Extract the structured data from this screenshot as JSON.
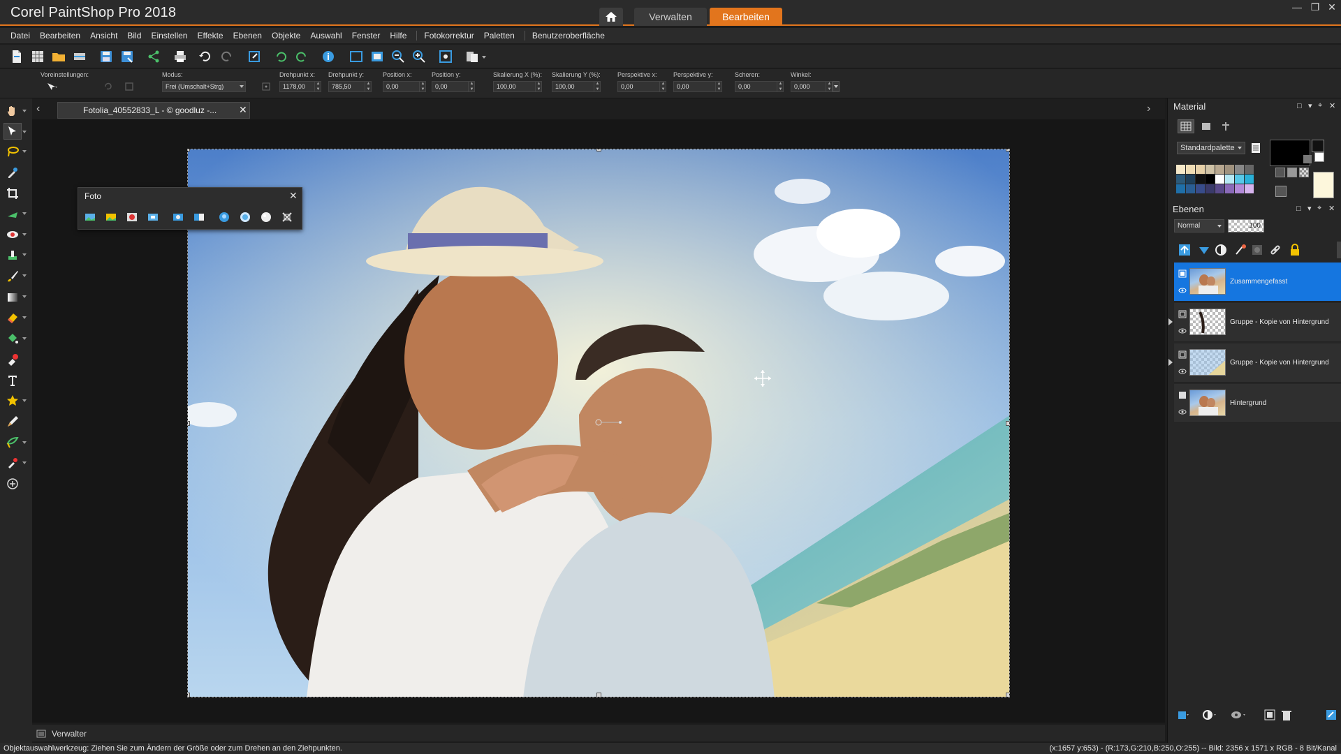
{
  "app": {
    "title": "Corel PaintShop Pro 2018"
  },
  "workspace_tabs": {
    "manage": "Verwalten",
    "edit": "Bearbeiten"
  },
  "menu": [
    "Datei",
    "Bearbeiten",
    "Ansicht",
    "Bild",
    "Einstellen",
    "Effekte",
    "Ebenen",
    "Objekte",
    "Auswahl",
    "Fenster",
    "Hilfe",
    "Fotokorrektur",
    "Paletten",
    "Benutzeroberfläche"
  ],
  "options": {
    "presets_label": "Voreinstellungen:",
    "mode_label": "Modus:",
    "mode_value": "Frei (Umschalt+Strg)",
    "pivot_x_label": "Drehpunkt x:",
    "pivot_x": "1178,00",
    "pivot_y_label": "Drehpunkt y:",
    "pivot_y": "785,50",
    "pos_x_label": "Position x:",
    "pos_x": "0,00",
    "pos_y_label": "Position y:",
    "pos_y": "0,00",
    "scale_x_label": "Skalierung X (%):",
    "scale_x": "100,00",
    "scale_y_label": "Skalierung Y (%):",
    "scale_y": "100,00",
    "persp_x_label": "Perspektive x:",
    "persp_x": "0,00",
    "persp_y_label": "Perspektive y:",
    "persp_y": "0,00",
    "shear_label": "Scheren:",
    "shear": "0,00",
    "angle_label": "Winkel:",
    "angle": "0,000"
  },
  "document": {
    "tab_title": "Fotolia_40552833_L - © goodluz -..."
  },
  "foto_panel": {
    "title": "Foto"
  },
  "material": {
    "title": "Material",
    "palette": "Standardpalette"
  },
  "layers": {
    "title": "Ebenen",
    "blend_mode": "Normal",
    "opacity": "100",
    "items": [
      {
        "name": "Zusammengefasst",
        "active": true
      },
      {
        "name": "Gruppe - Kopie von Hintergrund"
      },
      {
        "name": "Gruppe - Kopie von Hintergrund"
      },
      {
        "name": "Hintergrund"
      }
    ]
  },
  "bottom": {
    "verwalter": "Verwalter"
  },
  "status": {
    "left": "Objektauswahlwerkzeug: Ziehen Sie zum Ändern der Größe oder zum Drehen an den Ziehpunkten.",
    "right": "(x:1657 y:653) - (R:173,G:210,B:250,O:255) -- Bild: 2356 x 1571 x RGB - 8 Bit/Kanal"
  },
  "colors": {
    "accent": "#e2751d",
    "layer_selected": "#1576e0"
  }
}
